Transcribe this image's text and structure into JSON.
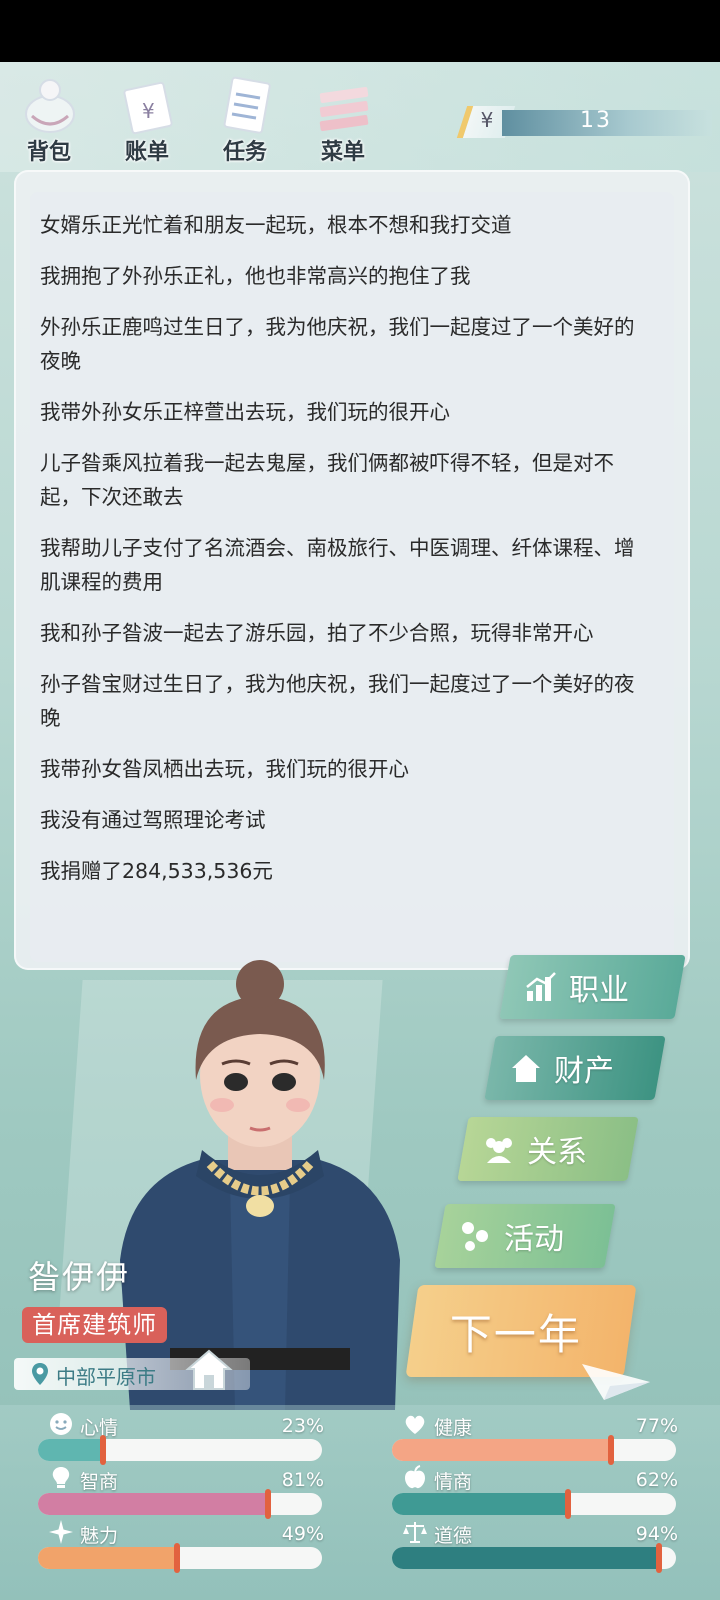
{
  "topmenu": {
    "items": [
      {
        "label": "背包",
        "icon": "backpack-icon"
      },
      {
        "label": "账单",
        "icon": "bill-icon"
      },
      {
        "label": "任务",
        "icon": "task-icon"
      },
      {
        "label": "菜单",
        "icon": "menu-icon"
      }
    ],
    "money": {
      "currency_symbol": "¥",
      "amount": "13"
    }
  },
  "log": [
    "女婿乐正光忙着和朋友一起玩，根本不想和我打交道",
    "我拥抱了外孙乐正礼，他也非常高兴的抱住了我",
    "外孙乐正鹿鸣过生日了，我为他庆祝，我们一起度过了一个美好的夜晚",
    "我带外孙女乐正梓萱出去玩，我们玩的很开心",
    "儿子昝乘风拉着我一起去鬼屋，我们俩都被吓得不轻，但是对不起，下次还敢去",
    "我帮助儿子支付了名流酒会、南极旅行、中医调理、纤体课程、增肌课程的费用",
    "我和孙子昝波一起去了游乐园，拍了不少合照，玩得非常开心",
    "孙子昝宝财过生日了，我为他庆祝，我们一起度过了一个美好的夜晚",
    "我带孙女昝凤栖出去玩，我们玩的很开心",
    "我没有通过驾照理论考试",
    "我捐赠了284,533,536元"
  ],
  "actions": {
    "career": "职业",
    "assets": "财产",
    "relations": "关系",
    "activity": "活动",
    "next_year": "下一年"
  },
  "character": {
    "name": "昝伊伊",
    "title": "首席建筑师",
    "location": "中部平原市"
  },
  "stats": {
    "mood": {
      "label": "心情",
      "value": "23%",
      "level": 0.23,
      "color": "#5fb6b0"
    },
    "health": {
      "label": "健康",
      "value": "77%",
      "level": 0.77,
      "color": "#f4a585"
    },
    "intelligence": {
      "label": "智商",
      "value": "81%",
      "level": 0.81,
      "color": "#d27ea3"
    },
    "eq": {
      "label": "情商",
      "value": "62%",
      "level": 0.62,
      "color": "#3f9a94"
    },
    "charm": {
      "label": "魅力",
      "value": "49%",
      "level": 0.49,
      "color": "#f1a36a"
    },
    "morality": {
      "label": "道德",
      "value": "94%",
      "level": 0.94,
      "color": "#2e7f80"
    }
  }
}
